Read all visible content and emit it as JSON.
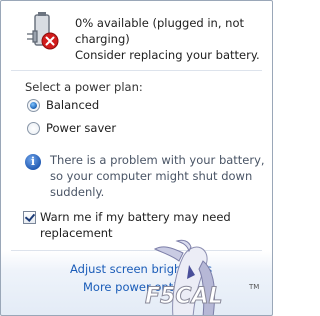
{
  "status": {
    "line1": "0% available (plugged in, not charging)",
    "line2": "Consider replacing your battery."
  },
  "power_plan": {
    "label": "Select a power plan:",
    "options": [
      {
        "label": "Balanced",
        "selected": true
      },
      {
        "label": "Power saver",
        "selected": false
      }
    ]
  },
  "warning": {
    "text": "There is a problem with your battery, so your computer might shut down suddenly."
  },
  "warn_checkbox": {
    "label": "Warn me if my battery may need replacement",
    "checked": true
  },
  "links": {
    "adjust_brightness": "Adjust screen brightness",
    "more_options": "More power options"
  },
  "watermark": {
    "text": "F5CAL",
    "tm": "TM"
  },
  "colors": {
    "link": "#1a5cb8",
    "accent": "#1f57b0",
    "error": "#d11b1b"
  },
  "icons": [
    "battery-icon",
    "error-x-icon",
    "plug-icon",
    "info-icon",
    "checkbox-checked-icon"
  ]
}
